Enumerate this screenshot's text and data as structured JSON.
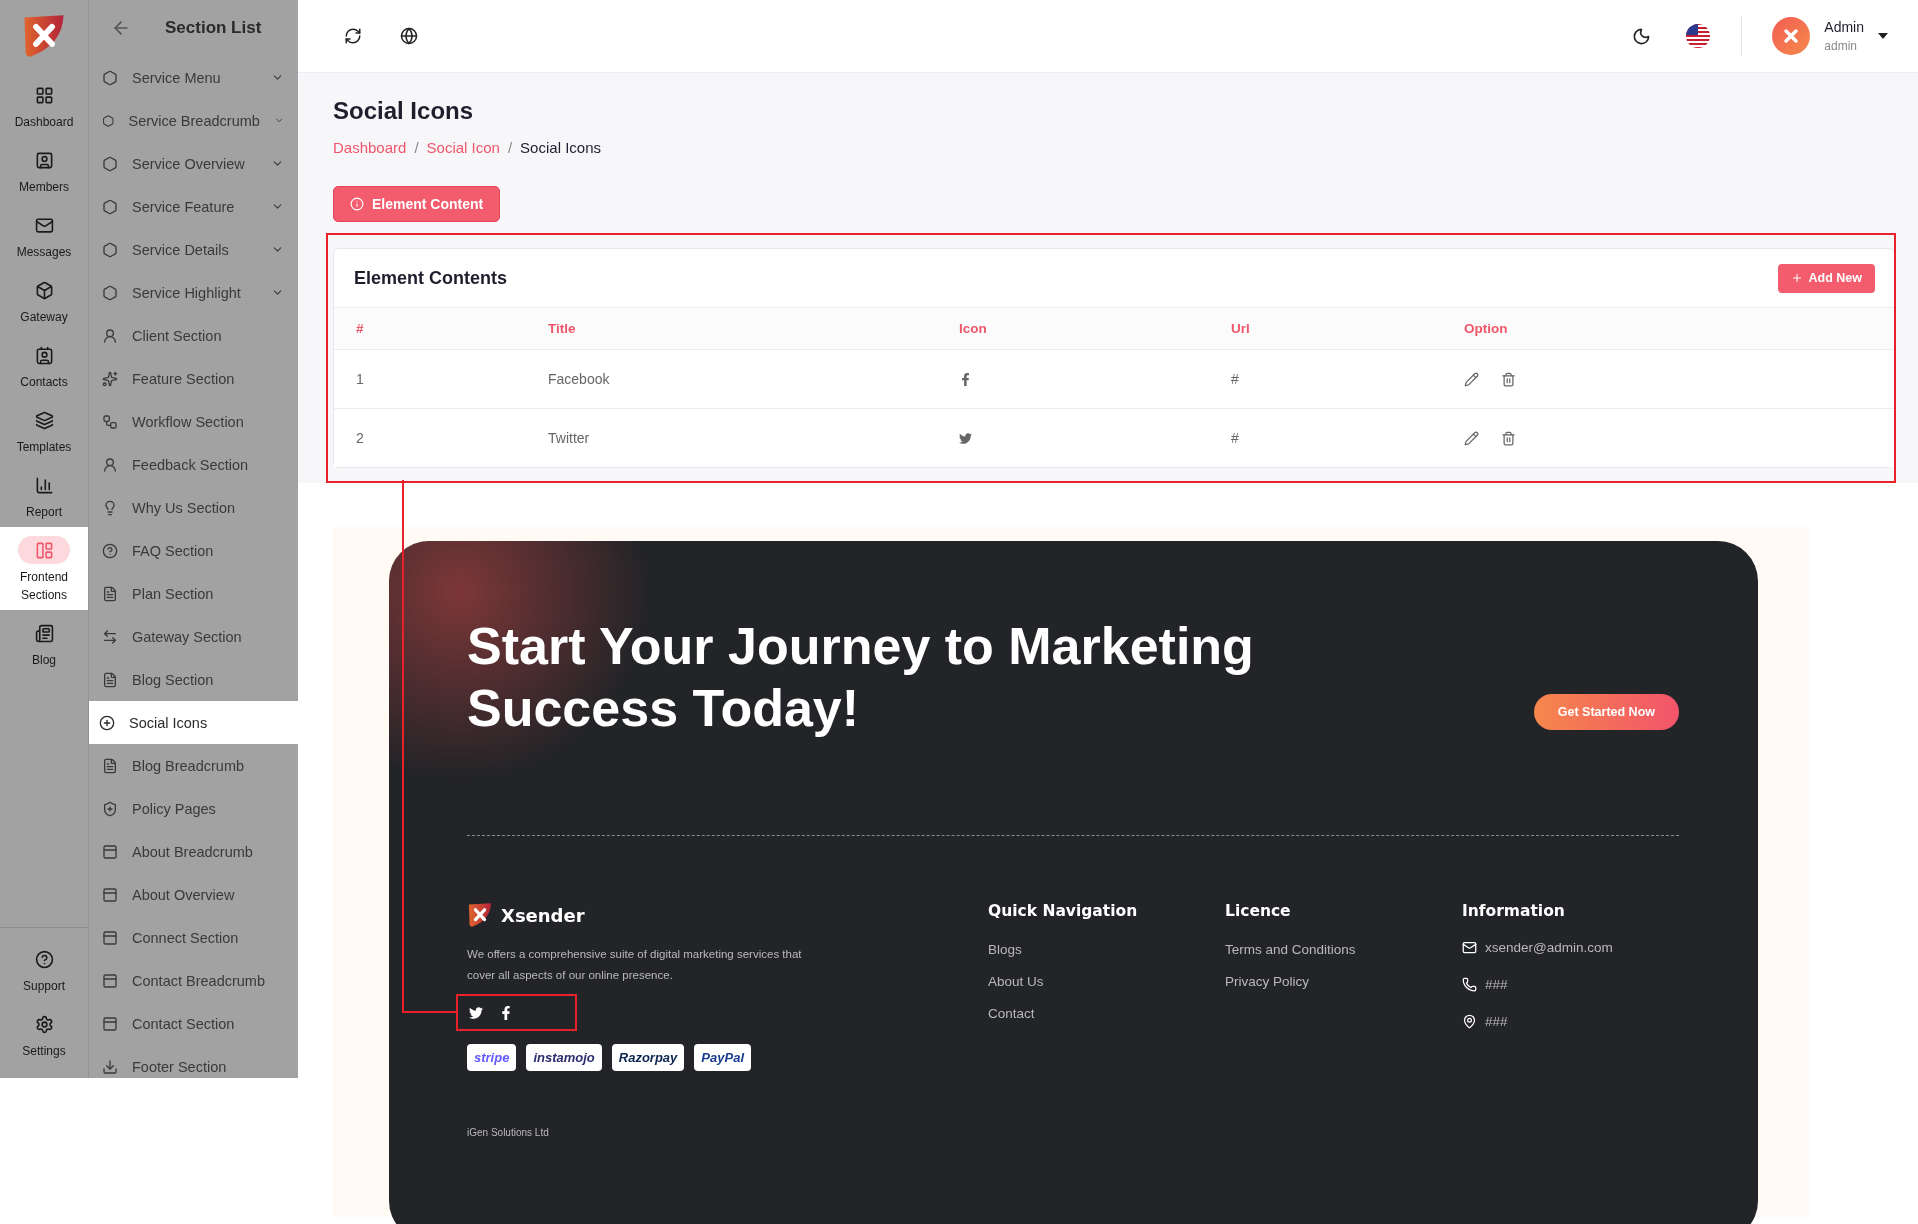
{
  "rail": {
    "items": [
      {
        "label": "Dashboard",
        "selected": false
      },
      {
        "label": "Members",
        "selected": false
      },
      {
        "label": "Messages",
        "selected": false
      },
      {
        "label": "Gateway",
        "selected": false
      },
      {
        "label": "Contacts",
        "selected": false
      },
      {
        "label": "Templates",
        "selected": false
      },
      {
        "label": "Report",
        "selected": false
      },
      {
        "label": "Frontend Sections",
        "selected": true
      },
      {
        "label": "Blog",
        "selected": false
      }
    ],
    "bottom_items": [
      {
        "label": "Support",
        "selected": false
      },
      {
        "label": "Settings",
        "selected": false
      }
    ]
  },
  "section_list": {
    "title": "Section List",
    "items": [
      {
        "label": "Service Menu",
        "selected": false,
        "expandable": true
      },
      {
        "label": "Service Breadcrumb",
        "selected": false,
        "expandable": true
      },
      {
        "label": "Service Overview",
        "selected": false,
        "expandable": true
      },
      {
        "label": "Service Feature",
        "selected": false,
        "expandable": true
      },
      {
        "label": "Service Details",
        "selected": false,
        "expandable": true
      },
      {
        "label": "Service Highlight",
        "selected": false,
        "expandable": true
      },
      {
        "label": "Client Section",
        "selected": false,
        "expandable": false
      },
      {
        "label": "Feature Section",
        "selected": false,
        "expandable": false
      },
      {
        "label": "Workflow Section",
        "selected": false,
        "expandable": false
      },
      {
        "label": "Feedback Section",
        "selected": false,
        "expandable": false
      },
      {
        "label": "Why Us Section",
        "selected": false,
        "expandable": false
      },
      {
        "label": "FAQ Section",
        "selected": false,
        "expandable": false
      },
      {
        "label": "Plan Section",
        "selected": false,
        "expandable": false
      },
      {
        "label": "Gateway Section",
        "selected": false,
        "expandable": false
      },
      {
        "label": "Blog Section",
        "selected": false,
        "expandable": false
      },
      {
        "label": "Social Icons",
        "selected": true,
        "expandable": false
      },
      {
        "label": "Blog Breadcrumb",
        "selected": false,
        "expandable": false
      },
      {
        "label": "Policy Pages",
        "selected": false,
        "expandable": false
      },
      {
        "label": "About Breadcrumb",
        "selected": false,
        "expandable": false
      },
      {
        "label": "About Overview",
        "selected": false,
        "expandable": false
      },
      {
        "label": "Connect Section",
        "selected": false,
        "expandable": false
      },
      {
        "label": "Contact Breadcrumb",
        "selected": false,
        "expandable": false
      },
      {
        "label": "Contact Section",
        "selected": false,
        "expandable": false
      },
      {
        "label": "Footer Section",
        "selected": false,
        "expandable": false
      }
    ]
  },
  "header": {
    "user": {
      "name": "Admin",
      "role": "admin"
    }
  },
  "page": {
    "title": "Social Icons",
    "breadcrumb": [
      "Dashboard",
      "Social Icon",
      "Social Icons"
    ],
    "breadcrumb_separator": "/",
    "action_button": "Element Content"
  },
  "table": {
    "title": "Element Contents",
    "add_button": "Add New",
    "columns": [
      "#",
      "Title",
      "Icon",
      "Url",
      "Option"
    ],
    "rows": [
      {
        "index": "1",
        "title": "Facebook",
        "kind": "facebook",
        "url": "#"
      },
      {
        "index": "2",
        "title": "Twitter",
        "kind": "twitter",
        "url": "#"
      }
    ]
  },
  "preview": {
    "headline": "Start Your Journey to Marketing Success Today!",
    "cta": "Get Started Now",
    "brand": "Xsender",
    "description": "We offers a comprehensive suite of digital marketing services that cover all aspects of our online presence.",
    "social": [
      {
        "kind": "twitter"
      },
      {
        "kind": "facebook"
      }
    ],
    "payments": [
      {
        "label": "stripe",
        "color": "#635bff"
      },
      {
        "label": "instamojo",
        "color": "#2b2d6e"
      },
      {
        "label": "Razorpay",
        "color": "#0c2651"
      },
      {
        "label": "PayPal",
        "color": "#1a3d8f"
      }
    ],
    "columns": [
      {
        "title": "Quick Navigation",
        "links": [
          "Blogs",
          "About Us",
          "Contact"
        ]
      },
      {
        "title": "Licence",
        "links": [
          "Terms and Conditions",
          "Privacy Policy"
        ]
      }
    ],
    "information": {
      "title": "Information",
      "items": [
        {
          "kind": "email",
          "text": "xsender@admin.com"
        },
        {
          "kind": "phone",
          "text": "###"
        },
        {
          "kind": "location",
          "text": "###"
        }
      ]
    },
    "copyright": "iGen Solutions Ltd"
  }
}
